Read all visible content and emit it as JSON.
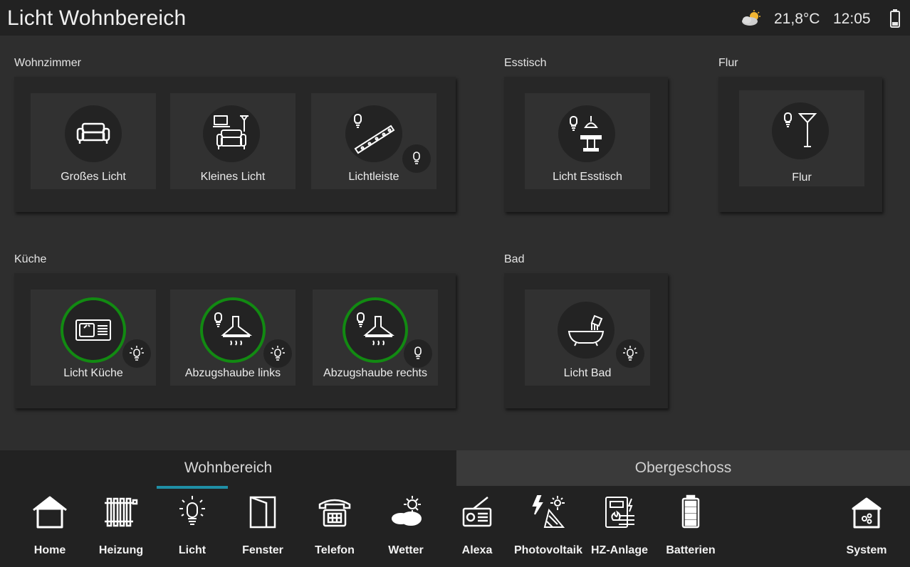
{
  "header": {
    "title": "Licht Wohnbereich",
    "temperature": "21,8°C",
    "time": "12:05"
  },
  "sections": {
    "wohnzimmer": {
      "label": "Wohnzimmer",
      "tiles": [
        {
          "label": "Großes Licht",
          "icon": "sofa-icon"
        },
        {
          "label": "Kleines Licht",
          "icon": "sofa-tv-lamp-icon"
        },
        {
          "label": "Lichtleiste",
          "icon": "led-strip-icon",
          "badge": "bulb-off-icon"
        }
      ]
    },
    "esstisch": {
      "label": "Esstisch",
      "tiles": [
        {
          "label": "Licht Esstisch",
          "icon": "dining-table-lamp-icon"
        }
      ]
    },
    "flur": {
      "label": "Flur",
      "tiles": [
        {
          "label": "Flur",
          "icon": "floor-lamp-icon"
        }
      ]
    },
    "kueche": {
      "label": "Küche",
      "tiles": [
        {
          "label": "Licht Küche",
          "icon": "kitchen-sink-icon",
          "badge": "bulb-on-icon",
          "state": "on"
        },
        {
          "label": "Abzugshaube links",
          "icon": "range-hood-icon",
          "badge": "bulb-on-icon",
          "state": "on"
        },
        {
          "label": "Abzugshaube rechts",
          "icon": "range-hood-icon",
          "badge": "bulb-off-icon",
          "state": "on"
        }
      ]
    },
    "bad": {
      "label": "Bad",
      "tiles": [
        {
          "label": "Licht Bad",
          "icon": "bathtub-icon",
          "badge": "bulb-on-icon"
        }
      ]
    }
  },
  "tabs": [
    {
      "label": "Wohnbereich",
      "active": true
    },
    {
      "label": "Obergeschoss",
      "active": false
    }
  ],
  "nav": [
    {
      "label": "Home",
      "icon": "home-icon"
    },
    {
      "label": "Heizung",
      "icon": "radiator-icon"
    },
    {
      "label": "Licht",
      "icon": "light-bulb-icon"
    },
    {
      "label": "Fenster",
      "icon": "window-icon"
    },
    {
      "label": "Telefon",
      "icon": "telephone-icon"
    },
    {
      "label": "Wetter",
      "icon": "weather-icon"
    },
    {
      "label": "Alexa",
      "icon": "radio-icon"
    },
    {
      "label": "Photovoltaik",
      "icon": "solar-panel-icon"
    },
    {
      "label": "HZ-Anlage",
      "icon": "heating-system-icon"
    },
    {
      "label": "Batterien",
      "icon": "battery-icon"
    },
    {
      "label": "System",
      "icon": "system-house-icon"
    }
  ],
  "colors": {
    "active_ring": "#128a12",
    "tab_indicator": "#1f8fa6",
    "background": "#2e2e2e"
  }
}
